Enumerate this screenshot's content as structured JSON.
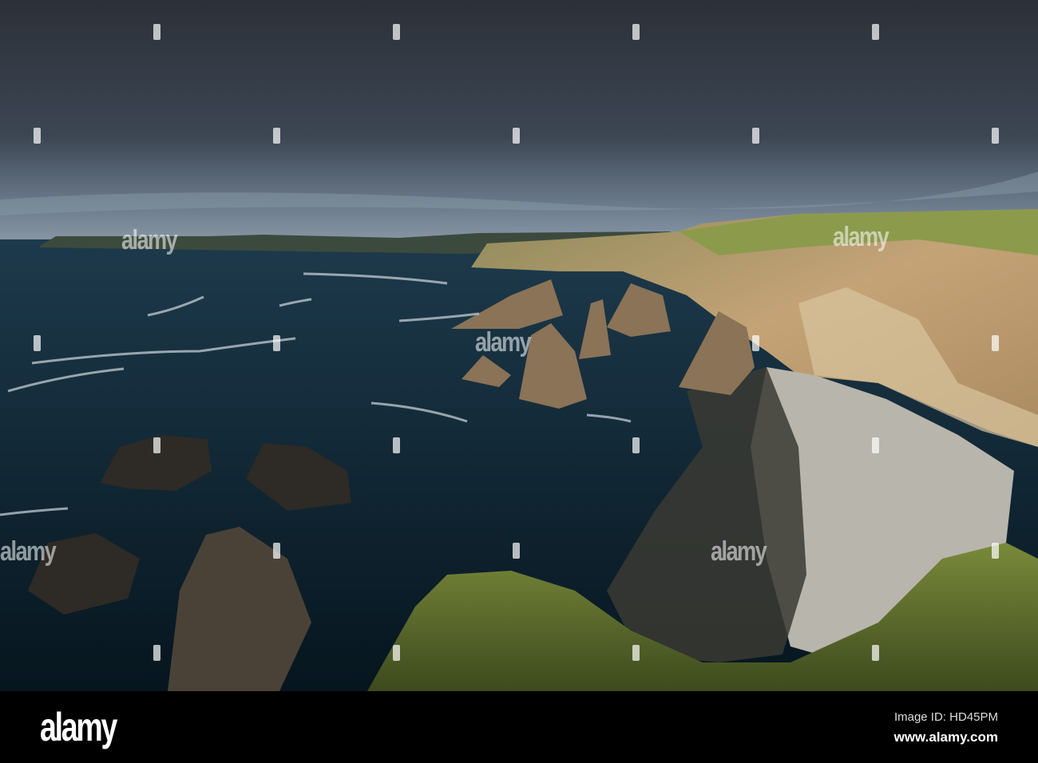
{
  "photo": {
    "subject": "Sea stacks and cliffs along a rocky coastline under a dark cloudy sky",
    "colors": {
      "sky_top": "#30353e",
      "sky_horizon": "#7c8a99",
      "sea": "#0f2633",
      "cliff": "#b99a6f",
      "grass": "#7f8f3e",
      "beach": "#b8b5ac"
    }
  },
  "watermark": {
    "text": "alamy"
  },
  "footer": {
    "logo": "alamy",
    "image_id": "Image ID: HD45PM",
    "website": "www.alamy.com"
  }
}
